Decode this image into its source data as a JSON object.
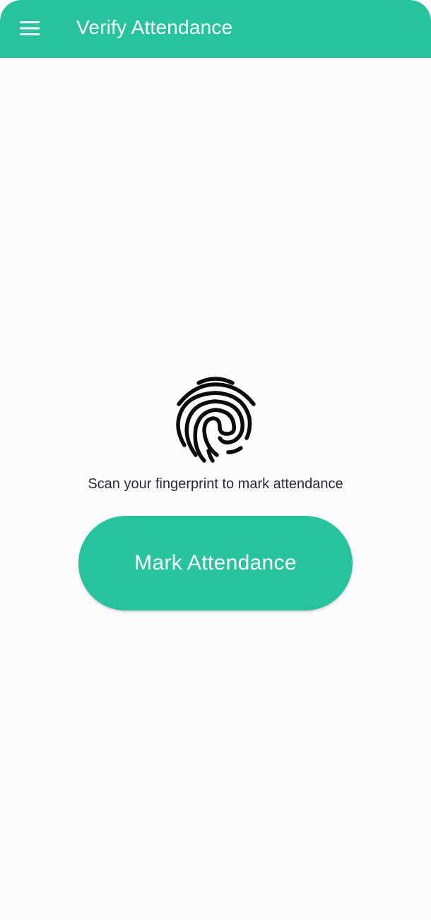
{
  "app_bar": {
    "title": "Verify Attendance",
    "menu_icon": "hamburger-menu-icon",
    "color": "#27c39c"
  },
  "main": {
    "icon": "fingerprint-icon",
    "prompt": "Scan your fingerprint to mark attendance",
    "button_label": "Mark Attendance",
    "button_color": "#27c39c"
  },
  "colors": {
    "background": "#fefbfe",
    "accent": "#27c39c",
    "text": "#2a2a2e"
  }
}
